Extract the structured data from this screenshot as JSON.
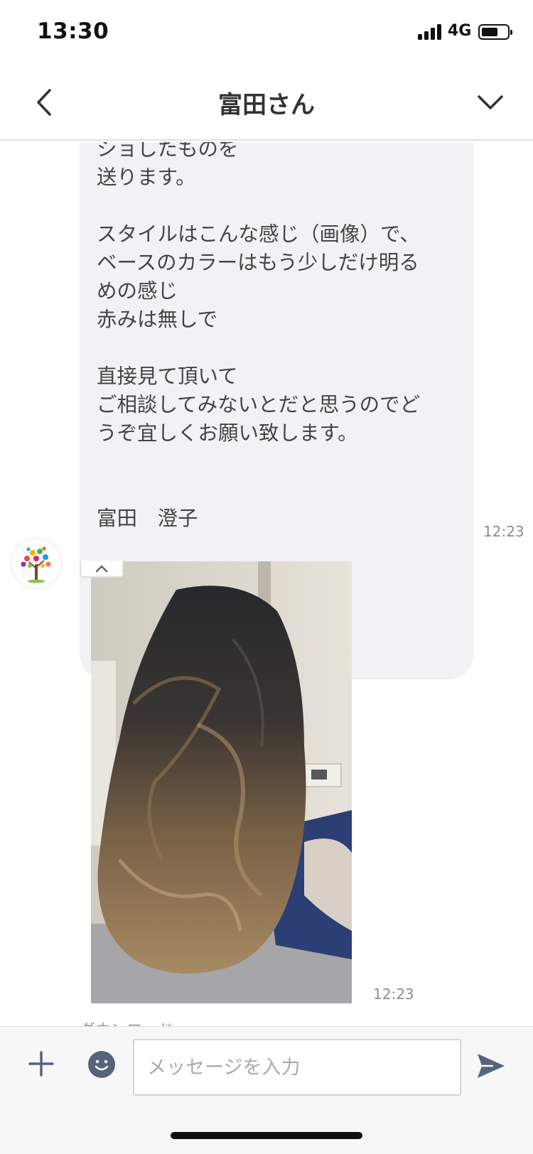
{
  "status_bar": {
    "time": "13:30",
    "network": "4G"
  },
  "header": {
    "title": "富田さん"
  },
  "messages": {
    "first": {
      "text": "ショしたものを\n送ります。\n\nスタイルはこんな感じ（画像）で、\nベースのカラーはもう少しだけ明る\nめの感じ\n赤みは無しで\n\n直接見て頂いて\nご相談してみないとだと思うのでど\nうぞ宜しくお願い致します。\n\n\n富田　澄子",
      "time": "12:23"
    },
    "second": {
      "time": "12:23",
      "download_label": "ダウンロード"
    }
  },
  "input": {
    "placeholder": "メッセージを入力"
  },
  "colors": {
    "icon": "#55647a",
    "bubble": "#f1f2f4"
  }
}
